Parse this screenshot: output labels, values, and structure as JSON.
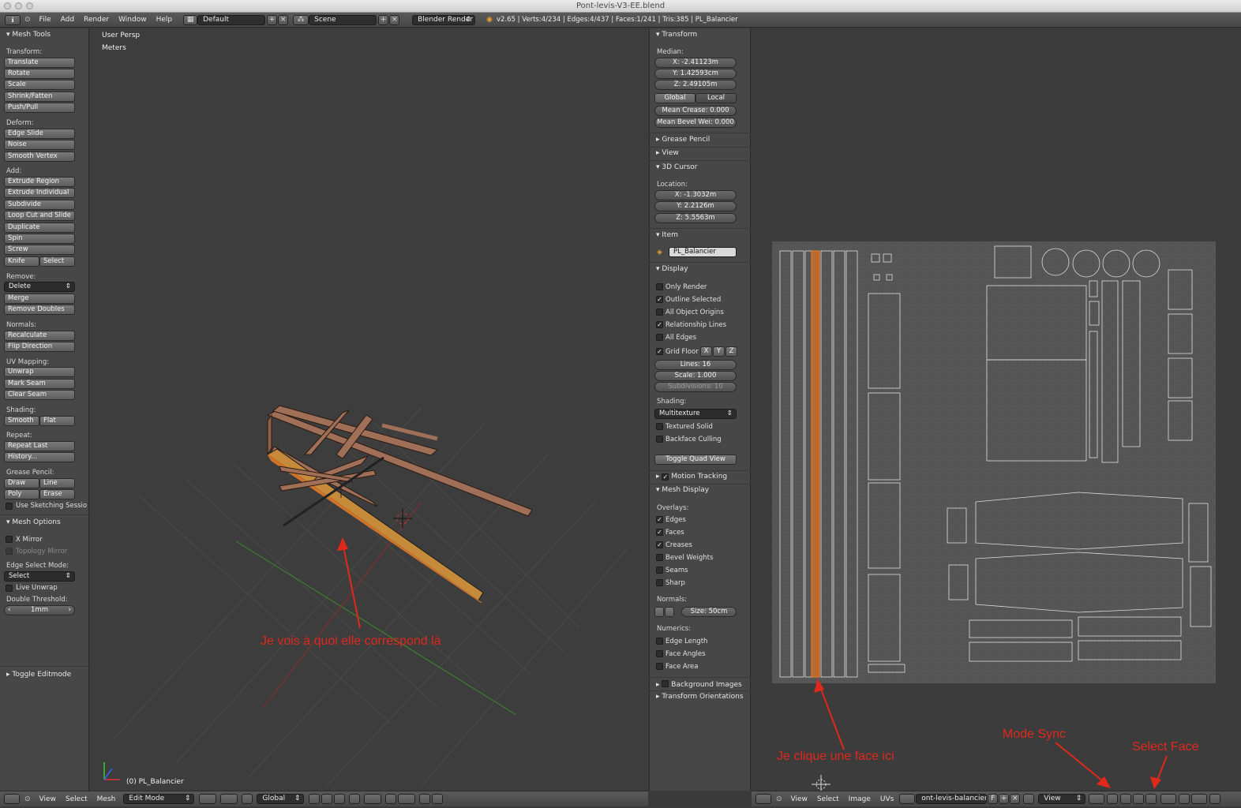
{
  "window": {
    "title": "Pont-levis-V3-EE.blend"
  },
  "topbar": {
    "menus": [
      "File",
      "Add",
      "Render",
      "Window",
      "Help"
    ],
    "layout": "Default",
    "scene": "Scene",
    "engine": "Blender Render",
    "stats": "v2.65 | Verts:4/234 | Edges:4/437 | Faces:1/241 | Tris:385 | PL_Balancier"
  },
  "toolshelf": {
    "title": "Mesh Tools",
    "transform_label": "Transform:",
    "transform": [
      "Translate",
      "Rotate",
      "Scale",
      "Shrink/Fatten",
      "Push/Pull"
    ],
    "deform_label": "Deform:",
    "deform": [
      "Edge Slide",
      "Noise",
      "Smooth Vertex"
    ],
    "add_label": "Add:",
    "add": [
      "Extrude Region",
      "Extrude Individual",
      "Subdivide",
      "Loop Cut and Slide",
      "Duplicate",
      "Spin",
      "Screw"
    ],
    "knife": "Knife",
    "select": "Select",
    "remove_label": "Remove:",
    "delete": "Delete",
    "remove": [
      "Merge",
      "Remove Doubles"
    ],
    "normals_label": "Normals:",
    "normals": [
      "Recalculate",
      "Flip Direction"
    ],
    "uv_label": "UV Mapping:",
    "uv": [
      "Unwrap",
      "Mark Seam",
      "Clear Seam"
    ],
    "shading_label": "Shading:",
    "smooth": "Smooth",
    "flat": "Flat",
    "repeat_label": "Repeat:",
    "repeat": [
      "Repeat Last",
      "History..."
    ],
    "grease_label": "Grease Pencil:",
    "draw": "Draw",
    "line": "Line",
    "poly": "Poly",
    "erase": "Erase",
    "sketching": "Use Sketching Sessio",
    "mesh_options": "Mesh Options",
    "x_mirror": "X Mirror",
    "topology_mirror": "Topology Mirror",
    "edge_select_label": "Edge Select Mode:",
    "edge_select_value": "Select",
    "live_unwrap": "Live Unwrap",
    "double_threshold_label": "Double Threshold:",
    "double_threshold_value": "1mm",
    "toggle_editmode": "Toggle Editmode"
  },
  "viewport": {
    "view_name": "User Persp",
    "units": "Meters",
    "object_label": "(0) PL_Balancier",
    "annotation": "Je vois à quoi elle correspond là"
  },
  "properties": {
    "transform_title": "Transform",
    "median_label": "Median:",
    "median": [
      "X: -2.41123m",
      "Y: 1.42593cm",
      "Z: 2.49105m"
    ],
    "global": "Global",
    "local": "Local",
    "mean_crease": "Mean Crease: 0.000",
    "mean_bevel": "Mean Bevel Wei: 0.000",
    "grease_pencil": "Grease Pencil",
    "view": "View",
    "cursor_title": "3D Cursor",
    "location_label": "Location:",
    "cursor": [
      "X: -1.3032m",
      "Y: 2.2126m",
      "Z: 5.5563m"
    ],
    "item_title": "Item",
    "item_name": "PL_Balancier",
    "display_title": "Display",
    "display_checks": [
      {
        "label": "Only Render",
        "checked": false
      },
      {
        "label": "Outline Selected",
        "checked": true
      },
      {
        "label": "All Object Origins",
        "checked": false
      },
      {
        "label": "Relationship Lines",
        "checked": true
      },
      {
        "label": "All Edges",
        "checked": false
      }
    ],
    "grid_floor": "Grid Floor",
    "axes": [
      "X",
      "Y",
      "Z"
    ],
    "lines": "Lines: 16",
    "scale": "Scale: 1.000",
    "subdivisions": "Subdivisions: 10",
    "shading_label": "Shading:",
    "shading_value": "Multitexture",
    "textured_solid": "Textured Solid",
    "backface_culling": "Backface Culling",
    "toggle_quad": "Toggle Quad View",
    "motion_tracking": "Motion Tracking",
    "mesh_display": "Mesh Display",
    "overlays_label": "Overlays:",
    "overlays": [
      {
        "label": "Edges",
        "checked": true
      },
      {
        "label": "Faces",
        "checked": true
      },
      {
        "label": "Creases",
        "checked": true
      },
      {
        "label": "Bevel Weights",
        "checked": false
      },
      {
        "label": "Seams",
        "checked": false
      },
      {
        "label": "Sharp",
        "checked": false
      }
    ],
    "normals_label": "Normals:",
    "normals_size": "Size: 50cm",
    "numerics_label": "Numerics:",
    "numerics": [
      "Edge Length",
      "Face Angles",
      "Face Area"
    ],
    "background_images": "Background Images",
    "transform_orientations": "Transform Orientations"
  },
  "uv": {
    "annot_click": "Je clique une face ici",
    "annot_sync": "Mode Sync",
    "annot_select": "Select Face"
  },
  "bottom_3d": {
    "menus": [
      "View",
      "Select",
      "Mesh"
    ],
    "mode": "Edit Mode",
    "orientation": "Global"
  },
  "bottom_uv": {
    "menus": [
      "View",
      "Select",
      "Image",
      "UVs"
    ],
    "image": "ont-levis-balancier.png",
    "f": "F",
    "view": "View"
  },
  "colors": {
    "annotation": "#e0281b",
    "selection": "#e07a2a",
    "beam": "#a06f58"
  }
}
